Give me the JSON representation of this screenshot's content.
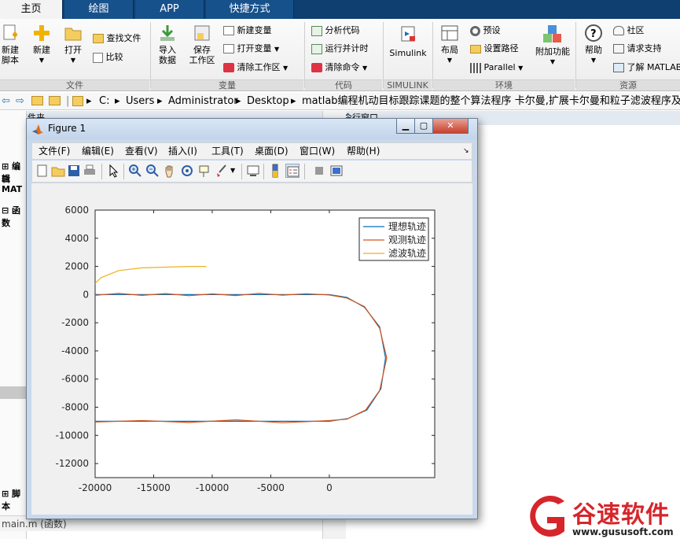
{
  "tabs": [
    "主页",
    "绘图",
    "APP",
    "快捷方式"
  ],
  "ribbon": {
    "file": {
      "new_script": "新建\n脚本",
      "new": "新建",
      "open": "打开",
      "find_files": "查找文件",
      "compare": "比较",
      "group": "文件"
    },
    "variable": {
      "import": "导入\n数据",
      "save_ws": "保存\n工作区",
      "new_var": "新建变量",
      "open_var": "打开变量",
      "clear_ws": "清除工作区",
      "group": "变量"
    },
    "code": {
      "analyze": "分析代码",
      "run_time": "运行并计时",
      "clear_cmd": "清除命令",
      "group": "代码"
    },
    "simulink": {
      "label": "Simulink",
      "group": "SIMULINK"
    },
    "env": {
      "layout": "布局",
      "prefs": "预设",
      "set_path": "设置路径",
      "parallel": "Parallel",
      "addons": "附加功能",
      "group": "环境"
    },
    "resources": {
      "help": "帮助",
      "community": "社区",
      "support": "请求支持",
      "learn": "了解 MATLAB",
      "group": "资源"
    }
  },
  "address": {
    "path": [
      "C:",
      "Users",
      "Administrator",
      "Desktop",
      "matlab编程机动目标跟踪课题的整个算法程序 卡尔曼,扩展卡尔曼和粒子滤波程序及其仿真"
    ]
  },
  "panels": {
    "current_folder": "当前文件夹",
    "command_window": "命令行窗口",
    "edit": "编辑",
    "mat": "MAT",
    "func": "函数",
    "script": "脚本",
    "file_item": "main.m  (函数)"
  },
  "figure": {
    "title": "Figure 1",
    "menus": [
      "文件(F)",
      "编辑(E)",
      "查看(V)",
      "插入(I)",
      "工具(T)",
      "桌面(D)",
      "窗口(W)",
      "帮助(H)"
    ]
  },
  "chart_data": {
    "type": "line",
    "xlim": [
      -20000,
      9000
    ],
    "ylim": [
      -13000,
      6000
    ],
    "xticks": [
      -20000,
      -15000,
      -10000,
      -5000,
      0
    ],
    "yticks": [
      6000,
      4000,
      2000,
      0,
      -2000,
      -4000,
      -6000,
      -8000,
      -10000,
      -12000
    ],
    "legend_position": "top-right",
    "series": [
      {
        "name": "理想轨迹",
        "color": "#0072bd",
        "points": [
          [
            -20000,
            0
          ],
          [
            0,
            0
          ],
          [
            1500,
            -200
          ],
          [
            3000,
            -900
          ],
          [
            4300,
            -2300
          ],
          [
            4800,
            -4500
          ],
          [
            4400,
            -6700
          ],
          [
            3200,
            -8200
          ],
          [
            1600,
            -8800
          ],
          [
            0,
            -9000
          ],
          [
            -20000,
            -9000
          ]
        ]
      },
      {
        "name": "观测轨迹",
        "color": "#d95319",
        "points": [
          [
            -20000,
            -50
          ],
          [
            -18000,
            80
          ],
          [
            -16000,
            -60
          ],
          [
            -14000,
            70
          ],
          [
            -12000,
            -80
          ],
          [
            -10000,
            50
          ],
          [
            -8000,
            -70
          ],
          [
            -6000,
            90
          ],
          [
            -4000,
            -40
          ],
          [
            -2000,
            60
          ],
          [
            0,
            -30
          ],
          [
            1500,
            -250
          ],
          [
            3000,
            -850
          ],
          [
            4300,
            -2400
          ],
          [
            4900,
            -4500
          ],
          [
            4300,
            -6800
          ],
          [
            3100,
            -8200
          ],
          [
            1500,
            -8850
          ],
          [
            0,
            -8950
          ],
          [
            -4000,
            -9100
          ],
          [
            -8000,
            -8900
          ],
          [
            -12000,
            -9080
          ],
          [
            -16000,
            -8950
          ],
          [
            -20000,
            -9050
          ]
        ]
      },
      {
        "name": "滤波轨迹",
        "color": "#edb120",
        "points": [
          [
            -20000,
            800
          ],
          [
            -19500,
            1200
          ],
          [
            -18000,
            1700
          ],
          [
            -16000,
            1900
          ],
          [
            -14000,
            1950
          ],
          [
            -12000,
            2000
          ],
          [
            -10500,
            2000
          ]
        ]
      }
    ]
  },
  "watermark": {
    "brand": "谷速软件",
    "url": "www.gususoft.com"
  }
}
